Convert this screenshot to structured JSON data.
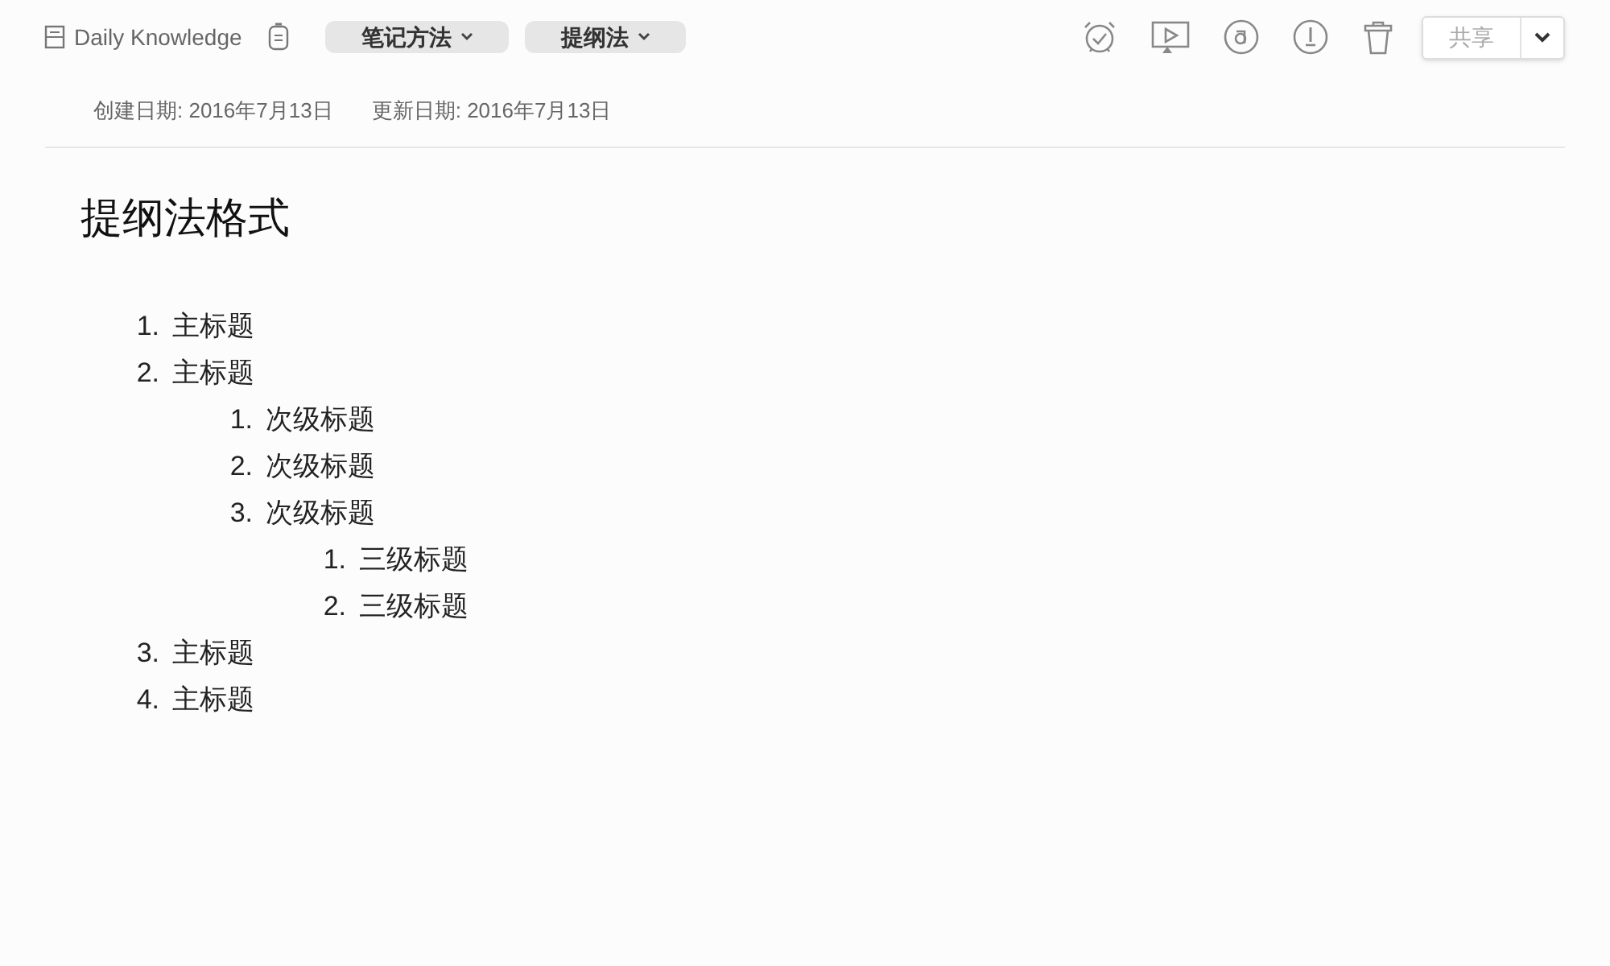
{
  "notebook": "Daily Knowledge",
  "tags": [
    {
      "label": "笔记方法"
    },
    {
      "label": "提纲法"
    }
  ],
  "share_button": "共享",
  "dates": [
    "创建日期: 2016年7月13日",
    "更新日期: 2016年7月13日"
  ],
  "note": {
    "title": "提纲法格式",
    "outline": [
      {
        "number": "1.",
        "text": "主标题"
      },
      {
        "number": "2.",
        "text": "主标题",
        "children": [
          {
            "number": "1.",
            "text": "次级标题"
          },
          {
            "number": "2.",
            "text": "次级标题"
          },
          {
            "number": "3.",
            "text": "次级标题",
            "children": [
              {
                "number": "1.",
                "text": "三级标题"
              },
              {
                "number": "2.",
                "text": "三级标题"
              }
            ]
          }
        ]
      },
      {
        "number": "3.",
        "text": "主标题"
      },
      {
        "number": "4.",
        "text": "主标题"
      }
    ]
  }
}
